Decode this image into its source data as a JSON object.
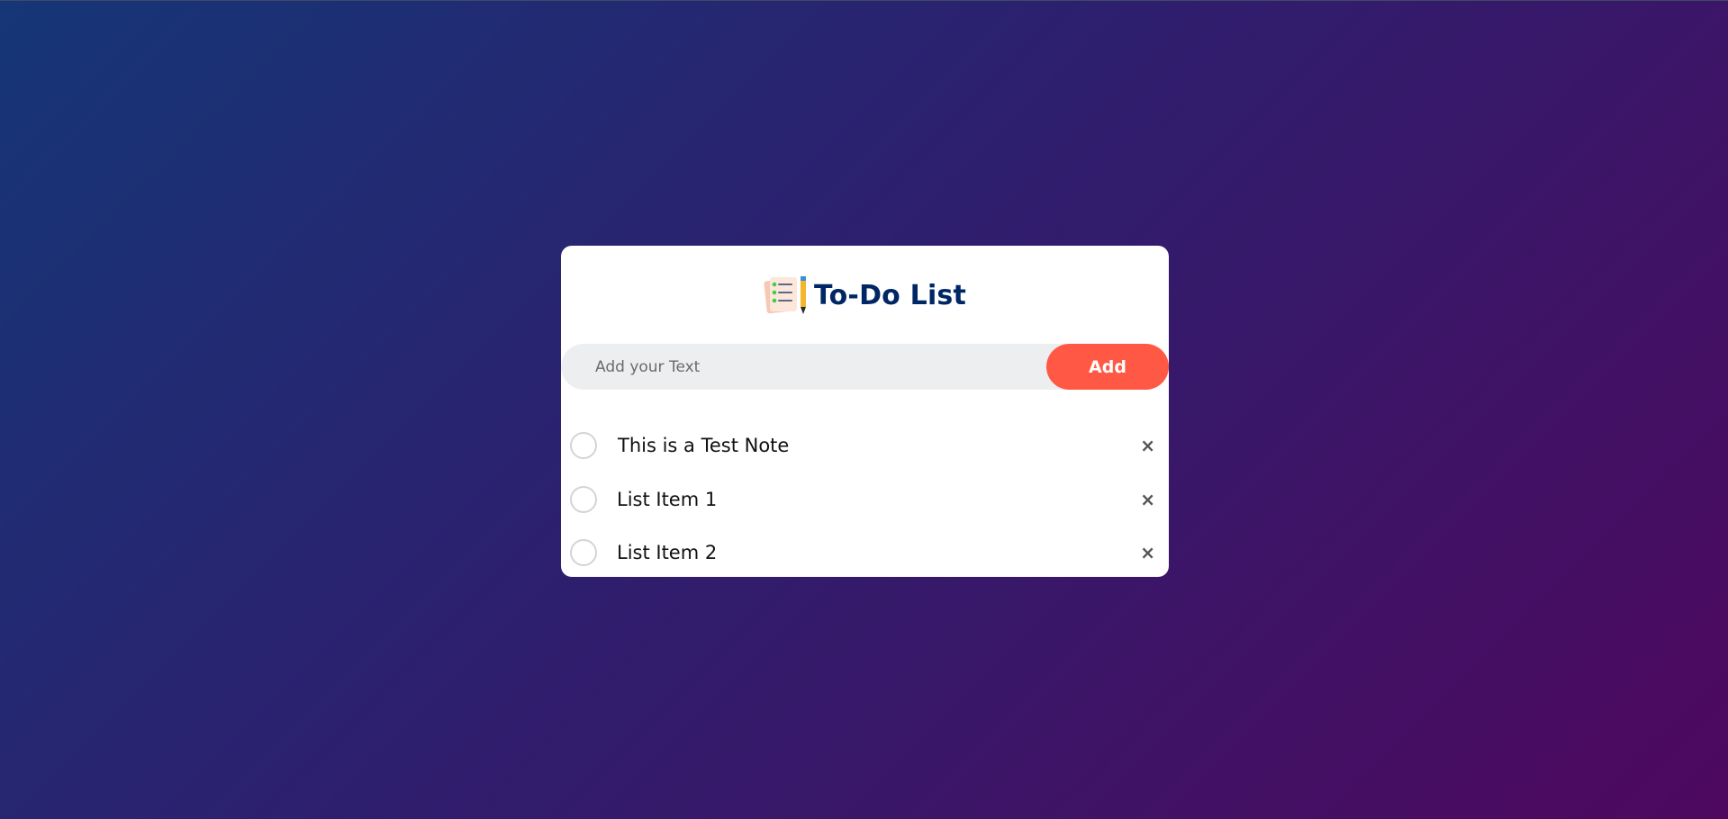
{
  "app": {
    "title": "To-Do List",
    "title_icon": "notepad-pencil-icon",
    "colors": {
      "background_start": "#153677",
      "background_end": "#4e085f",
      "title": "#002765",
      "add_button": "#ff5945",
      "input_background": "#edeef0"
    }
  },
  "input": {
    "placeholder": "Add your Text",
    "value": ""
  },
  "add_button": {
    "label": "Add"
  },
  "tasks": [
    {
      "text": "This is a Test Note",
      "checked": false,
      "delete_label": "×"
    },
    {
      "text": "List Item 1",
      "checked": false,
      "delete_label": "×"
    },
    {
      "text": "List Item 2",
      "checked": false,
      "delete_label": "×"
    }
  ]
}
